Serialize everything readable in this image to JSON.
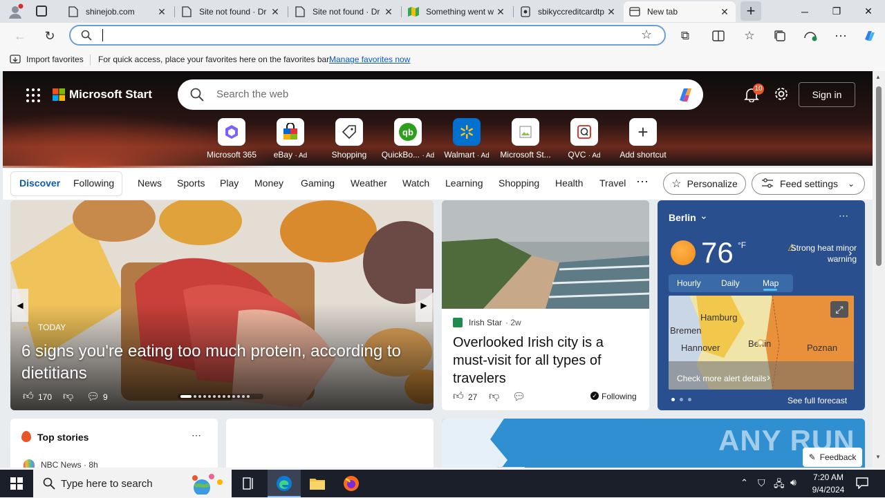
{
  "browser": {
    "tabs": [
      {
        "title": "shinejob.com",
        "active": false
      },
      {
        "title": "Site not found · Dr",
        "active": false
      },
      {
        "title": "Site not found · Dr",
        "active": false
      },
      {
        "title": "Something went w",
        "active": false
      },
      {
        "title": "sbikyccreditcardtp",
        "active": false
      },
      {
        "title": "New tab",
        "active": true
      }
    ],
    "address_value": "",
    "favorites_bar": {
      "import_label": "Import favorites",
      "hint": "For quick access, place your favorites here on the favorites bar.",
      "manage_link": "Manage favorites now"
    }
  },
  "page": {
    "brand": "Microsoft Start",
    "search_placeholder": "Search the web",
    "notifications_count": "10",
    "sign_in": "Sign in",
    "shortcuts": [
      {
        "label": "Microsoft 365",
        "ad": ""
      },
      {
        "label": "eBay",
        "ad": "· Ad"
      },
      {
        "label": "Shopping",
        "ad": ""
      },
      {
        "label": "QuickBo...",
        "ad": "· Ad"
      },
      {
        "label": "Walmart",
        "ad": "· Ad"
      },
      {
        "label": "Microsoft St...",
        "ad": ""
      },
      {
        "label": "QVC",
        "ad": "· Ad"
      },
      {
        "label": "Add shortcut",
        "ad": ""
      }
    ],
    "feed_tabs": {
      "discover": "Discover",
      "following": "Following",
      "items": [
        "News",
        "Sports",
        "Play",
        "Money",
        "Gaming",
        "Weather",
        "Watch",
        "Learning",
        "Shopping",
        "Health",
        "Travel"
      ],
      "personalize": "Personalize",
      "feed_settings": "Feed settings"
    },
    "hero_card": {
      "source": "TODAY",
      "headline": "6 signs you're eating too much protein, according to dietitians",
      "likes": "170",
      "comments": "9"
    },
    "irish_card": {
      "source": "Irish Star",
      "age": "· 2w",
      "headline": "Overlooked Irish city is a must-visit for all types of travelers",
      "likes": "27",
      "following": "Following"
    },
    "weather": {
      "city": "Berlin",
      "temp": "76",
      "unit": "°F",
      "alert": "Strong heat minor warning",
      "tabs": [
        "Hourly",
        "Daily",
        "Map"
      ],
      "map_labels": [
        "Hamburg",
        "Bremen",
        "Hannover",
        "Berlin",
        "Poznan"
      ],
      "alert_link": "Check more alert details",
      "forecast_link": "See full forecast"
    },
    "top_stories": {
      "title": "Top stories",
      "first_source": "NBC News · 8h"
    },
    "feedback": "Feedback",
    "watermark": "ANY RUN"
  },
  "taskbar": {
    "search_placeholder": "Type here to search",
    "time": "7:20 AM",
    "date": "9/4/2024"
  }
}
